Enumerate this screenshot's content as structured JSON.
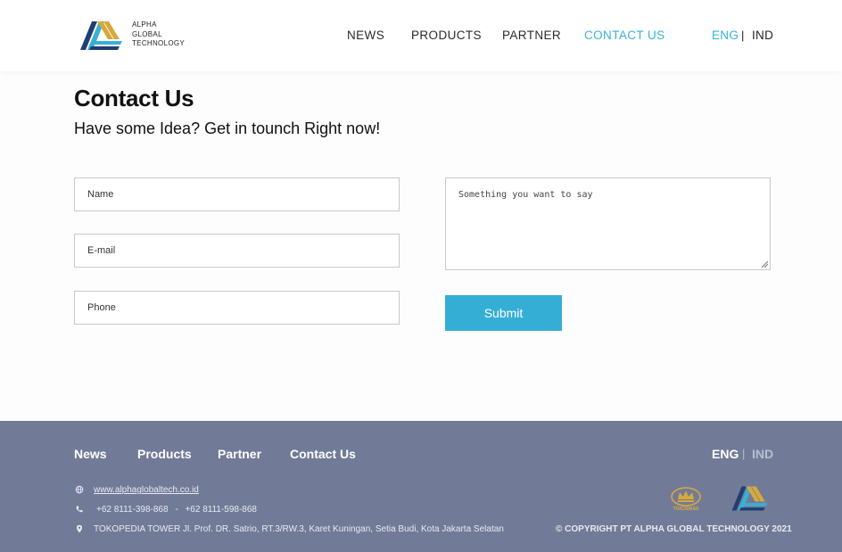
{
  "header": {
    "logo_lines": [
      "ALPHA",
      "GLOBAL",
      "TECHNOLOGY"
    ],
    "nav": [
      {
        "label": "NEWS"
      },
      {
        "label": "PRODUCTS"
      },
      {
        "label": "PARTNER"
      },
      {
        "label": "CONTACT US",
        "active": true
      }
    ],
    "lang": {
      "eng": "ENG",
      "sep": "|",
      "ind": "IND",
      "active": "ENG"
    }
  },
  "main": {
    "title": "Contact Us",
    "subtitle": "Have some Idea? Get in tounch Right now!",
    "form": {
      "name_placeholder": "Name",
      "email_placeholder": "E-mail",
      "phone_placeholder": "Phone",
      "message_placeholder": "Something you want to say",
      "submit_label": "Submit"
    }
  },
  "footer": {
    "nav": [
      "News",
      "Products",
      "Partner",
      "Contact Us"
    ],
    "lang": {
      "eng": "ENG",
      "sep": "|",
      "ind": "IND"
    },
    "website": "www.alphaglobaltech.co.id",
    "phone1": "+62 8111-398-868",
    "phone_sep": "-",
    "phone2": "+62 8111-598-868",
    "address": "TOKOPEDIA TOWER Jl. Prof. DR. Satrio, RT.3/RW.3, Karet Kuningan, Setia Budi, Kota Jakarta Selatan",
    "brand_label": "TOKOEMAS",
    "copyright": "© COPYRIGHT PT ALPHA GLOBAL TECHNOLOGY 2021"
  },
  "colors": {
    "accent": "#35aed6",
    "footer_bg": "#717b98",
    "logo_gold": "#d7a93a",
    "logo_navy": "#1f3f73",
    "logo_blue": "#3ab0d3"
  }
}
